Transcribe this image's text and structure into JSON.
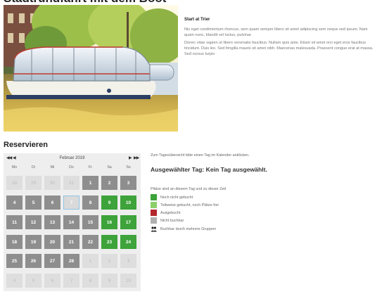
{
  "header": {
    "title": "Stadtrundfahrt mit dem Boot"
  },
  "intro": {
    "heading": "Start at Trier",
    "paragraph1": "Nis eget condimentum rhoncus, sem quam semper libero sit amet adipiscing sem neque sed ipsum. Nam quam nunc, blandit vel luctus, pulvinar.",
    "paragraph2": "Donec vitae sapien ut libero venenatis faucibus. Nullam quis ante. Etiam sit amet orci eget eros faucibus tincidunt. Duis leo. Sed fringilla mauris sit amet nibh. Maecenas malesuada. Praesent congue erat at massa. Sed cursus turpis"
  },
  "reservation": {
    "heading": "Reservieren",
    "calendar": {
      "month_label": "Februar 2019",
      "nav": {
        "prev_year": "◀◀",
        "prev_month": "◀",
        "next_month": "▶",
        "next_year": "▶▶"
      },
      "weekdays": [
        "Mo",
        "Di",
        "Mi",
        "Do",
        "Fr",
        "Sa",
        "So"
      ],
      "weeks": [
        [
          {
            "d": "28",
            "s": "other"
          },
          {
            "d": "29",
            "s": "other"
          },
          {
            "d": "30",
            "s": "other"
          },
          {
            "d": "31",
            "s": "other"
          },
          {
            "d": "1",
            "s": "avail"
          },
          {
            "d": "2",
            "s": "avail"
          },
          {
            "d": "3",
            "s": "avail"
          }
        ],
        [
          {
            "d": "4",
            "s": "avail"
          },
          {
            "d": "5",
            "s": "avail"
          },
          {
            "d": "6",
            "s": "avail"
          },
          {
            "d": "7",
            "s": "today"
          },
          {
            "d": "8",
            "s": "avail"
          },
          {
            "d": "9",
            "s": "green"
          },
          {
            "d": "10",
            "s": "green"
          }
        ],
        [
          {
            "d": "11",
            "s": "avail"
          },
          {
            "d": "12",
            "s": "avail"
          },
          {
            "d": "13",
            "s": "avail"
          },
          {
            "d": "14",
            "s": "avail"
          },
          {
            "d": "15",
            "s": "avail"
          },
          {
            "d": "16",
            "s": "green"
          },
          {
            "d": "17",
            "s": "green"
          }
        ],
        [
          {
            "d": "18",
            "s": "avail"
          },
          {
            "d": "19",
            "s": "avail"
          },
          {
            "d": "20",
            "s": "avail"
          },
          {
            "d": "21",
            "s": "avail"
          },
          {
            "d": "22",
            "s": "avail"
          },
          {
            "d": "23",
            "s": "green"
          },
          {
            "d": "24",
            "s": "green"
          }
        ],
        [
          {
            "d": "25",
            "s": "avail"
          },
          {
            "d": "26",
            "s": "avail"
          },
          {
            "d": "27",
            "s": "avail"
          },
          {
            "d": "28",
            "s": "avail"
          },
          {
            "d": "1",
            "s": "other"
          },
          {
            "d": "2",
            "s": "other"
          },
          {
            "d": "3",
            "s": "other"
          }
        ],
        [
          {
            "d": "4",
            "s": "other"
          },
          {
            "d": "5",
            "s": "other"
          },
          {
            "d": "6",
            "s": "other"
          },
          {
            "d": "7",
            "s": "other"
          },
          {
            "d": "8",
            "s": "other"
          },
          {
            "d": "9",
            "s": "other"
          },
          {
            "d": "10",
            "s": "other"
          }
        ]
      ]
    },
    "hint": "Zum Tagesübersicht bitte einen Tag im Kalender anklicken.",
    "selected_day": "Ausgewählter Tag: Kein Tag ausgewählt.",
    "legend": {
      "title": "Plätze sind an diesem Tag und zu dieser Zeit",
      "items": [
        {
          "label": "Noch nicht gebucht",
          "color": "#3da33a",
          "icon": "swatch"
        },
        {
          "label": "Teilweise gebucht, noch Plätze frei",
          "color": "#8ccf6a",
          "icon": "swatch"
        },
        {
          "label": "Ausgebucht",
          "color": "#b3262b",
          "icon": "swatch"
        },
        {
          "label": "Nicht buchbar",
          "color": "#b0b0b0",
          "icon": "swatch"
        },
        {
          "label": "Buchbar durch mehrere Gruppen",
          "color": "#222222",
          "icon": "group-icon"
        }
      ]
    }
  }
}
